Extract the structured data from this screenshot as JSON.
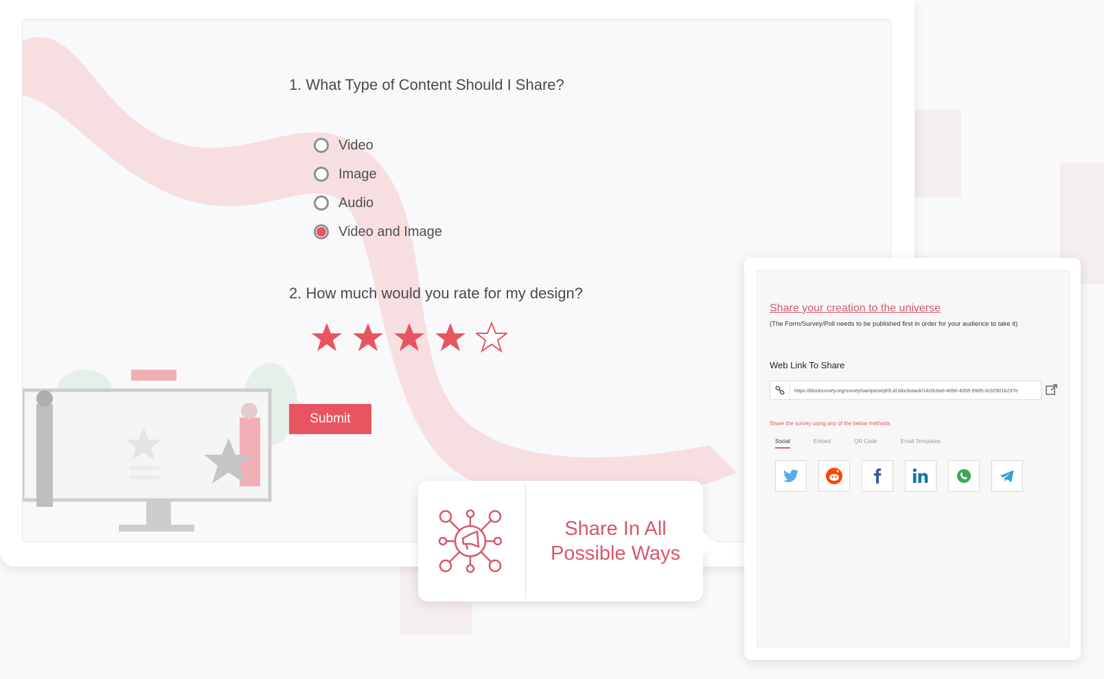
{
  "colors": {
    "accent": "#e85560",
    "accent_soft": "#f7dcdf",
    "text_pink": "#d4586a",
    "twitter": "#55acee",
    "reddit": "#ff4500",
    "facebook": "#3b5998",
    "linkedin": "#0e76a8",
    "whatsapp": "#25d366",
    "telegram": "#2aa3df"
  },
  "survey": {
    "question1": "1. What Type of Content Should I Share?",
    "options": [
      {
        "label": "Video",
        "selected": false
      },
      {
        "label": "Image",
        "selected": false
      },
      {
        "label": "Audio",
        "selected": false
      },
      {
        "label": "Video and Image",
        "selected": true
      }
    ],
    "question2": "2. How much would you rate for my design?",
    "rating": {
      "value": 4,
      "max": 5
    },
    "submit_label": "Submit"
  },
  "callout": {
    "icon": "megaphone-network-icon",
    "line1": "Share In All",
    "line2": "Possible Ways"
  },
  "share": {
    "title": "Share your creation to the universe",
    "note": "(The Form/Survey/Poll needs to be published first in order for your audience to take it)",
    "weblink_label": "Web Link To Share",
    "url": "https://blocksurvey.org/survey/samjoeseph5.id.blockstack/14c0c6a6-4090-42b5-9905-3c92901b237e",
    "methods_note": "Share the survey using any of the below methods",
    "tabs": [
      {
        "label": "Social",
        "active": true
      },
      {
        "label": "Embed",
        "active": false
      },
      {
        "label": "QR Code",
        "active": false
      },
      {
        "label": "Email Templates",
        "active": false
      }
    ],
    "social_icons": [
      "twitter-icon",
      "reddit-icon",
      "facebook-icon",
      "linkedin-icon",
      "whatsapp-icon",
      "telegram-icon"
    ]
  }
}
